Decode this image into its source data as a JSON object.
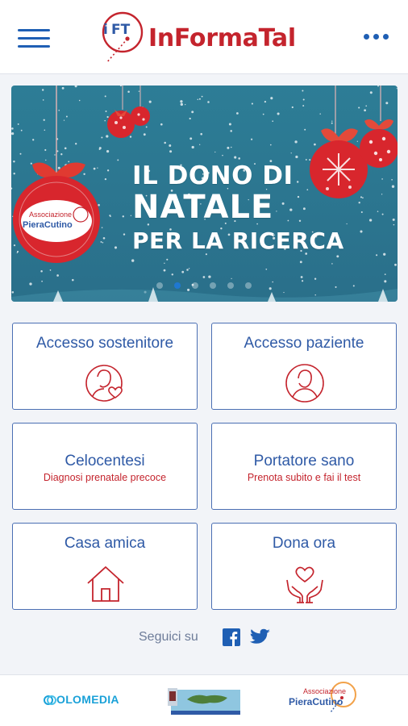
{
  "header": {
    "brand_mark": "iFT",
    "brand_name": "InFormaTal",
    "menu_icon": "hamburger-icon",
    "more_icon": "more-dots-icon"
  },
  "banner": {
    "line1": "IL DONO DI",
    "line2": "NATALE",
    "line3": "PER LA RICERCA",
    "ornament_badge_top": "Associazione",
    "ornament_badge_name": "PieraCutino",
    "carousel_slides": 6,
    "carousel_active_index": 1
  },
  "cards": [
    {
      "title": "Accesso sostenitore",
      "subtitle": "",
      "icon": "supporter-heart-icon"
    },
    {
      "title": "Accesso paziente",
      "subtitle": "",
      "icon": "patient-profile-icon"
    },
    {
      "title": "Celocentesi",
      "subtitle": "Diagnosi prenatale precoce",
      "icon": ""
    },
    {
      "title": "Portatore sano",
      "subtitle": "Prenota subito e fai il test",
      "icon": ""
    },
    {
      "title": "Casa amica",
      "subtitle": "",
      "icon": "house-icon"
    },
    {
      "title": "Dona ora",
      "subtitle": "",
      "icon": "donate-hands-heart-icon"
    }
  ],
  "social": {
    "label": "Seguici su",
    "networks": [
      "facebook-icon",
      "twitter-icon"
    ]
  },
  "footer": {
    "sponsors": [
      {
        "name": "OLOMEDIA"
      },
      {
        "name": ""
      },
      {
        "name_top": "Associazione",
        "name": "PieraCutino"
      }
    ]
  },
  "colors": {
    "brand_red": "#c4242d",
    "brand_blue": "#2f5aa6",
    "banner_teal": "#2d7d96",
    "page_bg": "#f2f4f8"
  }
}
